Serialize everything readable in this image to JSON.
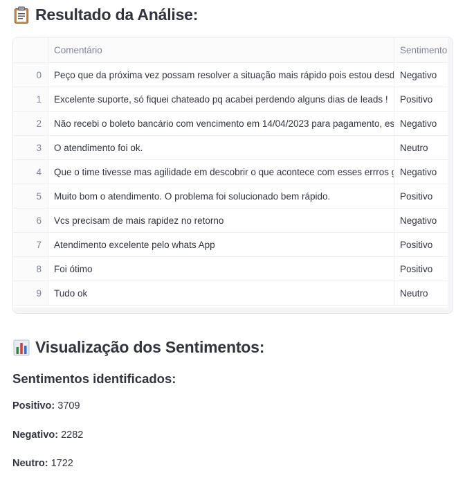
{
  "results": {
    "title": "Resultado da Análise:",
    "icon": "clipboard-icon"
  },
  "table": {
    "columns": [
      "",
      "Comentário",
      "Sentimento"
    ],
    "rows": [
      {
        "index": "0",
        "comentario": "Peço que da próxima vez possam resolver a situação mais rápido pois estou desde qu",
        "sentimento": "Negativo"
      },
      {
        "index": "1",
        "comentario": "Excelente suporte, só fiquei chateado pq acabei perdendo alguns dias de leads !",
        "sentimento": "Positivo"
      },
      {
        "index": "2",
        "comentario": "Não recebi o boleto bancário com vencimento em 14/04/2023 para pagamento, estou",
        "sentimento": "Negativo"
      },
      {
        "index": "3",
        "comentario": "O atendimento foi ok.",
        "sentimento": "Neutro"
      },
      {
        "index": "4",
        "comentario": "Que o time tivesse mas agilidade em descobrir o que acontece com esses errros grave",
        "sentimento": "Negativo"
      },
      {
        "index": "5",
        "comentario": "Muito bom o atendimento. O problema foi solucionado bem rápido.",
        "sentimento": "Positivo"
      },
      {
        "index": "6",
        "comentario": "Vcs precisam de mais rapidez no retorno",
        "sentimento": "Negativo"
      },
      {
        "index": "7",
        "comentario": "Atendimento excelente pelo whats App",
        "sentimento": "Positivo"
      },
      {
        "index": "8",
        "comentario": "Foi ótimo",
        "sentimento": "Positivo"
      },
      {
        "index": "9",
        "comentario": "Tudo ok",
        "sentimento": "Neutro"
      }
    ]
  },
  "visualization": {
    "title": "Visualização dos Sentimentos:",
    "icon": "bar-chart-icon",
    "subtitle": "Sentimentos identificados:",
    "stats": {
      "positivo_label": "Positivo:",
      "positivo_value": "3709",
      "negativo_label": "Negativo:",
      "negativo_value": "2282",
      "neutro_label": "Neutro:",
      "neutro_value": "1722"
    }
  },
  "colors": {
    "text": "#31333f",
    "muted": "#808495",
    "border": "#e6e8ee"
  }
}
